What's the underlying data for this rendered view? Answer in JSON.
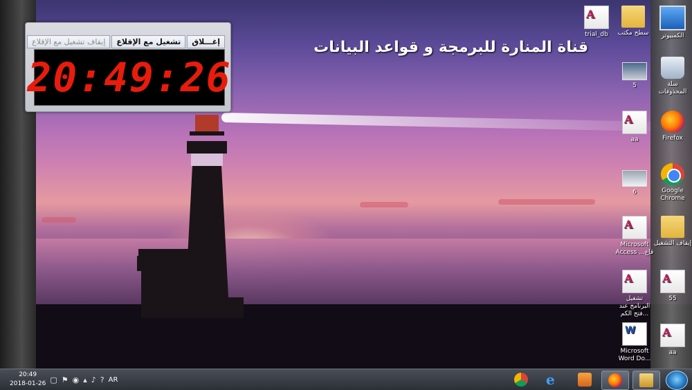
{
  "wallpaper": {
    "title": "قناة المنارة للبرمجة و قواعد البيانات"
  },
  "clock_window": {
    "buttons": {
      "close": "إغـــلاق",
      "start_with_boot": "تشغيل مع الإقلاع",
      "stop_with_boot": "إيقاف تشغيل مع الإقلاع"
    },
    "time": "20:49:26"
  },
  "desktop_icons": [
    {
      "id": "computer",
      "label": "الكمبيوتر",
      "icon": "computer-icon"
    },
    {
      "id": "desktop-folder",
      "label": "سطح مكتب",
      "icon": "folder-icon"
    },
    {
      "id": "trial-db",
      "label": "trial_db",
      "icon": "access-file-icon"
    },
    {
      "id": "recycle-bin",
      "label": "سلة المحذوفات",
      "icon": "recycle-bin-icon"
    },
    {
      "id": "img5",
      "label": "5",
      "icon": "image-icon"
    },
    {
      "id": "firefox",
      "label": "Firefox",
      "icon": "firefox-icon"
    },
    {
      "id": "aa1",
      "label": "aa",
      "icon": "access-file-icon"
    },
    {
      "id": "chrome",
      "label": "Google Chrome",
      "icon": "chrome-icon"
    },
    {
      "id": "img6",
      "label": "6",
      "icon": "image-icon"
    },
    {
      "id": "stop-run",
      "label": "إيقاف التشغيل",
      "icon": "folder-icon"
    },
    {
      "id": "access-shortcut",
      "label": "Microsoft Access ...قاع",
      "icon": "access-file-icon"
    },
    {
      "id": "f55",
      "label": "55",
      "icon": "access-file-icon"
    },
    {
      "id": "run-program",
      "label": "تشغيل البرنامج عند فتح الكم...",
      "icon": "access-file-icon"
    },
    {
      "id": "aa2",
      "label": "aa",
      "icon": "access-file-icon"
    },
    {
      "id": "word-doc",
      "label": "Microsoft Word Do...",
      "icon": "word-file-icon"
    }
  ],
  "taskbar": {
    "apps": [
      {
        "name": "chrome",
        "icon": "chrome-icon"
      },
      {
        "name": "internet-explorer",
        "icon": "ie-icon"
      },
      {
        "name": "media-player",
        "icon": "media-player-icon"
      },
      {
        "name": "firefox",
        "icon": "firefox-icon"
      },
      {
        "name": "windows-explorer",
        "icon": "folder-icon"
      }
    ],
    "tray": {
      "language": "AR",
      "time": "20:49",
      "date": "2018-01-26"
    }
  }
}
